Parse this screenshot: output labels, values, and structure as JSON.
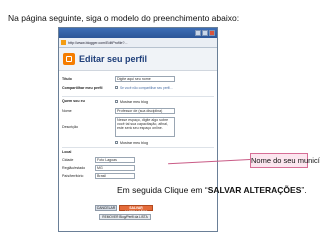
{
  "instructions": {
    "top": "Na página seguinte, siga o modelo do preenchimento abaixo:",
    "bottom_prefix": "Em seguida Clique em “",
    "bottom_highlight": "SALVAR ALTERAÇÕES",
    "bottom_suffix": "”."
  },
  "callout": {
    "text": "Nome do seu município."
  },
  "browser": {
    "url": "http://www.blogger.com/EditProfile?...",
    "page_title": "Editar seu perfil"
  },
  "form": {
    "titulo_label": "Título",
    "titulo_value": "Digite aqui seu nome",
    "compartilhar_label": "Compartilhar meu perfil",
    "compartilhar_hint": "Se você não compartilhar seu perfil...",
    "quem_label": "Quem sou eu",
    "mostrar_label": "Mostrar meu blog",
    "nome_label": "Nome",
    "nome_value": "Professor de (sua disciplina)",
    "descricao_label": "Descrição",
    "descricao_value": "Nesse espaço, digite algo sobre você tal sua capacitação, afinal, este será seu espaço online.",
    "local_label": "Local",
    "cidade_label": "Cidade",
    "cidade_value": "Foto Lagoas",
    "regiao_label": "Região/estado",
    "regiao_value": "MG",
    "pais_label": "País/território",
    "pais_value": "Brasil"
  },
  "buttons": {
    "cancel": "CANCELAR",
    "save": "SALVAR ALTERAÇÕES",
    "remove": "REMOVER Blog/Perfil da LISTA"
  }
}
